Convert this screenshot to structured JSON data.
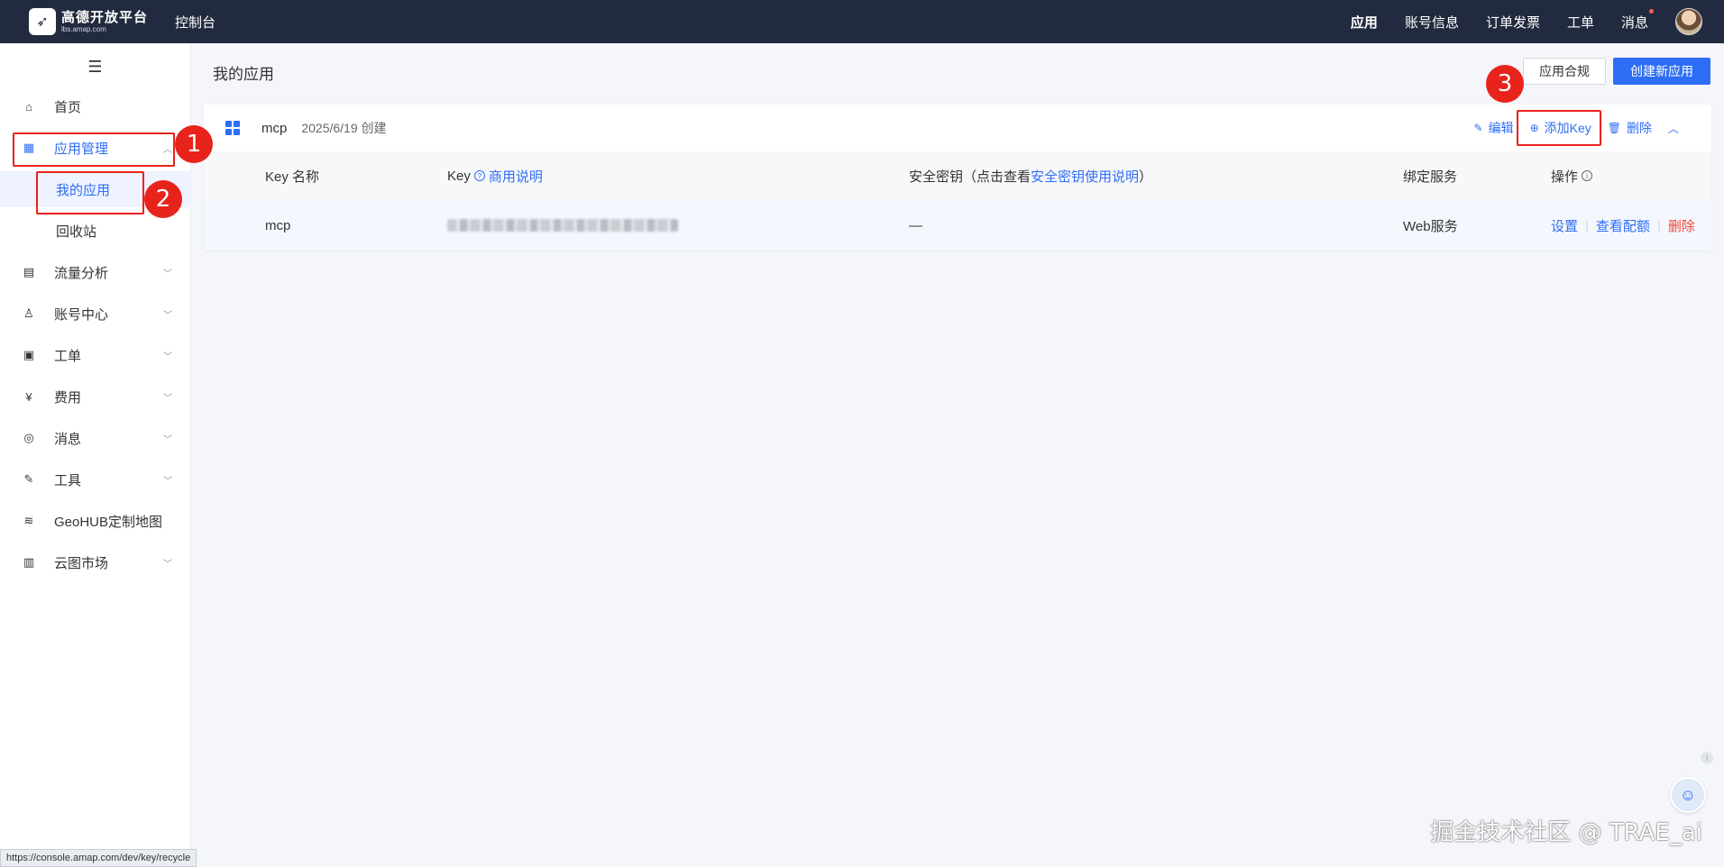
{
  "header": {
    "logo_title": "高德开放平台",
    "logo_sub": "lbs.amap.com",
    "console": "控制台",
    "nav": [
      "应用",
      "账号信息",
      "订单发票",
      "工单",
      "消息"
    ]
  },
  "sidebar": {
    "collapse_icon": "☰",
    "items": [
      {
        "label": "首页",
        "icon": "home-icon"
      },
      {
        "label": "应用管理",
        "icon": "apps-icon"
      },
      {
        "label": "我的应用"
      },
      {
        "label": "回收站"
      },
      {
        "label": "流量分析",
        "icon": "chart-icon"
      },
      {
        "label": "账号中心",
        "icon": "user-icon"
      },
      {
        "label": "工单",
        "icon": "ticket-icon"
      },
      {
        "label": "费用",
        "icon": "fee-icon"
      },
      {
        "label": "消息",
        "icon": "message-icon"
      },
      {
        "label": "工具",
        "icon": "wrench-icon"
      },
      {
        "label": "GeoHUB定制地图",
        "icon": "layers-icon"
      },
      {
        "label": "云图市场",
        "icon": "store-icon"
      }
    ]
  },
  "callouts": [
    "1",
    "2",
    "3"
  ],
  "main": {
    "title": "我的应用",
    "compliance_button": "应用合规",
    "create_button": "创建新应用",
    "app": {
      "name": "mcp",
      "created": "2025/6/19 创建",
      "actions": {
        "edit": "编辑",
        "add_key": "添加Key",
        "delete": "删除"
      }
    },
    "table": {
      "headers": {
        "key_name": "Key 名称",
        "key": "Key",
        "commercial": "商用说明",
        "secret_prefix": "安全密钥（点击查看",
        "secret_link": "安全密钥使用说明",
        "secret_suffix": "）",
        "service": "绑定服务",
        "ops": "操作"
      },
      "rows": [
        {
          "name": "mcp",
          "secret": "—",
          "service": "Web服务",
          "ops": [
            "设置",
            "查看配额",
            "删除"
          ]
        }
      ]
    }
  },
  "status_url": "https://console.amap.com/dev/key/recycle",
  "watermark": "掘金技术社区 @ TRAE_ai",
  "colors": {
    "accent": "#2e6df6",
    "topbar": "#222a3f",
    "callout": "#e8231b",
    "danger": "#f0483b"
  }
}
